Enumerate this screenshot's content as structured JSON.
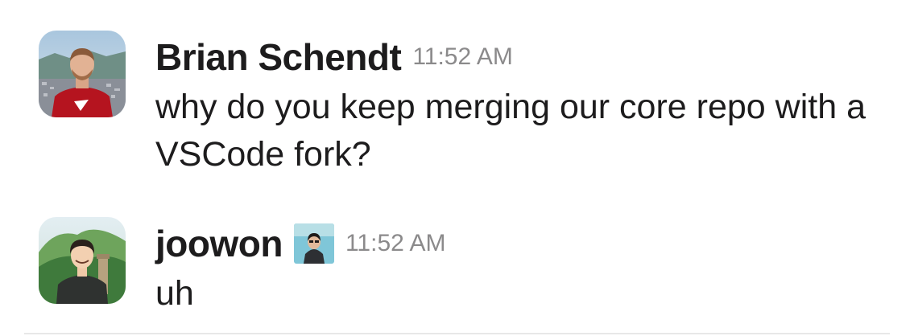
{
  "messages": [
    {
      "author": "Brian Schendt",
      "timestamp": "11:52 AM",
      "text": "why do you keep merging our core repo with a VSCode fork?",
      "avatar_icon": "user-avatar-photo"
    },
    {
      "author": "joowon",
      "timestamp": "11:52 AM",
      "text": "uh",
      "avatar_icon": "user-avatar-illustration",
      "status_icon": "custom-status-emoji"
    }
  ],
  "colors": {
    "text": "#1d1c1d",
    "timestamp": "#8b8a8b",
    "divider": "#e8e8e8"
  }
}
